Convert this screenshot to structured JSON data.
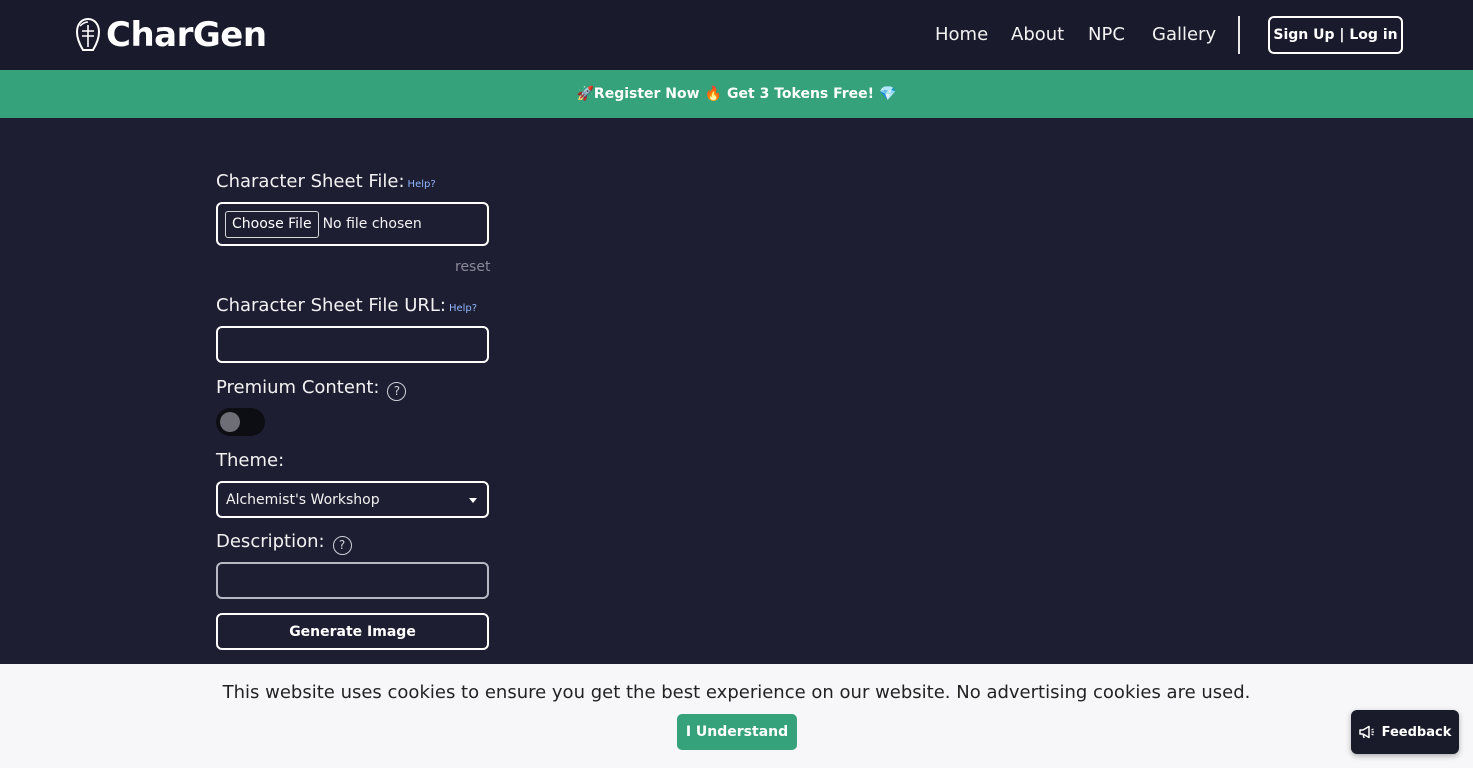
{
  "header": {
    "brand": "CharGen",
    "nav": [
      "Home",
      "About",
      "NPC",
      "Gallery"
    ],
    "auth_label": "Sign Up | Log in"
  },
  "promo": {
    "text_1": "🚀Register Now",
    "text_2": "🔥",
    "text_3": "Get 3 Tokens Free!",
    "text_4": "💎"
  },
  "form": {
    "sheet_file_label": "Character Sheet File:",
    "help": "Help?",
    "choose_file": "Choose File",
    "file_status": "No file chosen",
    "reset": "reset",
    "sheet_url_label": "Character Sheet File URL:",
    "sheet_url_value": "",
    "premium_label": "Premium Content:",
    "premium_enabled": false,
    "theme_label": "Theme:",
    "theme_value": "Alchemist's Workshop",
    "description_label": "Description:",
    "description_value": "",
    "generate": "Generate Image"
  },
  "cookie": {
    "text": "This website uses cookies to ensure you get the best experience on our website. No advertising cookies are used.",
    "accept": "I Understand"
  },
  "feedback": {
    "label": "Feedback"
  }
}
